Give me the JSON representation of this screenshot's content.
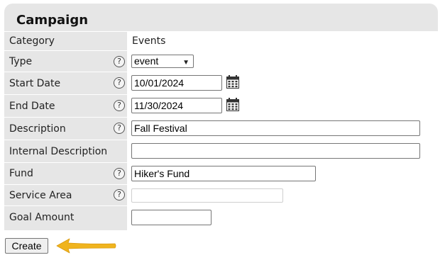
{
  "panel": {
    "title": "Campaign"
  },
  "fields": {
    "category": {
      "label": "Category",
      "value": "Events"
    },
    "type": {
      "label": "Type",
      "help": "?",
      "selected": "event"
    },
    "start_date": {
      "label": "Start Date",
      "help": "?",
      "value": "10/01/2024"
    },
    "end_date": {
      "label": "End Date",
      "help": "?",
      "value": "11/30/2024"
    },
    "description": {
      "label": "Description",
      "help": "?",
      "value": "Fall Festival"
    },
    "internal_description": {
      "label": "Internal Description",
      "value": ""
    },
    "fund": {
      "label": "Fund",
      "help": "?",
      "value": "Hiker's Fund"
    },
    "service_area": {
      "label": "Service Area",
      "help": "?",
      "value": ""
    },
    "goal_amount": {
      "label": "Goal Amount",
      "value": ""
    }
  },
  "actions": {
    "create_label": "Create"
  },
  "icons": {
    "calendar": "calendar-icon",
    "help": "help-icon",
    "dropdown": "chevron-down-icon",
    "pointer": "arrow-left-icon"
  },
  "colors": {
    "panel_bg": "#e6e6e6",
    "arrow": "#f0b41e"
  }
}
